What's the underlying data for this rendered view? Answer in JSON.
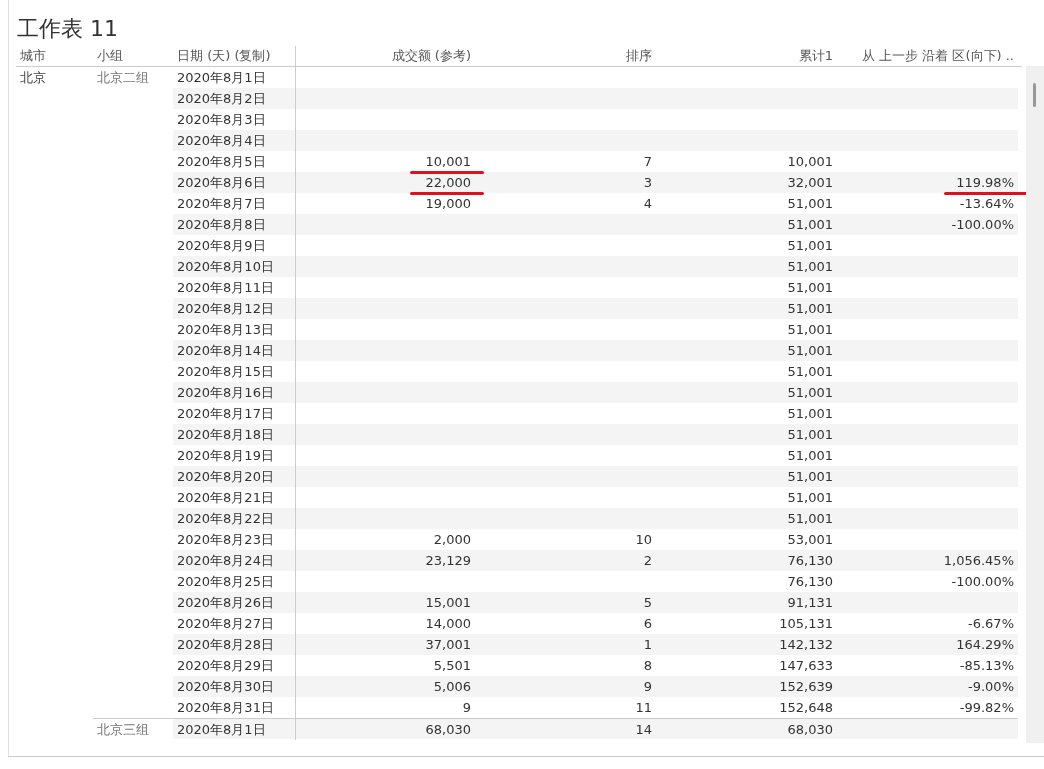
{
  "title": "工作表 11",
  "columns": [
    "城市",
    "小组",
    "日期 (天) (复制)",
    "成交额 (参考)",
    "排序",
    "累计1",
    "从 上一步 沿着 区(向下) .."
  ],
  "cities": [
    {
      "name": "北京",
      "groups": [
        {
          "name": "北京二组",
          "rows": [
            {
              "date": "2020年8月1日",
              "amount_marked": false,
              "change_marked": false
            },
            {
              "date": "2020年8月2日",
              "amount_marked": false,
              "change_marked": false
            },
            {
              "date": "2020年8月3日",
              "amount_marked": false,
              "change_marked": false
            },
            {
              "date": "2020年8月4日",
              "amount_marked": false,
              "change_marked": false
            },
            {
              "date": "2020年8月5日",
              "amount": "10,001",
              "rank": "7",
              "cumulative": "10,001",
              "amount_marked": true,
              "change_marked": false
            },
            {
              "date": "2020年8月6日",
              "amount": "22,000",
              "rank": "3",
              "cumulative": "32,001",
              "change": "119.98%",
              "amount_marked": true,
              "change_marked": true
            },
            {
              "date": "2020年8月7日",
              "amount": "19,000",
              "rank": "4",
              "cumulative": "51,001",
              "change": "-13.64%",
              "amount_marked": false,
              "change_marked": false
            },
            {
              "date": "2020年8月8日",
              "cumulative": "51,001",
              "change": "-100.00%",
              "amount_marked": false,
              "change_marked": false
            },
            {
              "date": "2020年8月9日",
              "cumulative": "51,001",
              "amount_marked": false,
              "change_marked": false
            },
            {
              "date": "2020年8月10日",
              "cumulative": "51,001",
              "amount_marked": false,
              "change_marked": false
            },
            {
              "date": "2020年8月11日",
              "cumulative": "51,001",
              "amount_marked": false,
              "change_marked": false
            },
            {
              "date": "2020年8月12日",
              "cumulative": "51,001",
              "amount_marked": false,
              "change_marked": false
            },
            {
              "date": "2020年8月13日",
              "cumulative": "51,001",
              "amount_marked": false,
              "change_marked": false
            },
            {
              "date": "2020年8月14日",
              "cumulative": "51,001",
              "amount_marked": false,
              "change_marked": false
            },
            {
              "date": "2020年8月15日",
              "cumulative": "51,001",
              "amount_marked": false,
              "change_marked": false
            },
            {
              "date": "2020年8月16日",
              "cumulative": "51,001",
              "amount_marked": false,
              "change_marked": false
            },
            {
              "date": "2020年8月17日",
              "cumulative": "51,001",
              "amount_marked": false,
              "change_marked": false
            },
            {
              "date": "2020年8月18日",
              "cumulative": "51,001",
              "amount_marked": false,
              "change_marked": false
            },
            {
              "date": "2020年8月19日",
              "cumulative": "51,001",
              "amount_marked": false,
              "change_marked": false
            },
            {
              "date": "2020年8月20日",
              "cumulative": "51,001",
              "amount_marked": false,
              "change_marked": false
            },
            {
              "date": "2020年8月21日",
              "cumulative": "51,001",
              "amount_marked": false,
              "change_marked": false
            },
            {
              "date": "2020年8月22日",
              "cumulative": "51,001",
              "amount_marked": false,
              "change_marked": false
            },
            {
              "date": "2020年8月23日",
              "amount": "2,000",
              "rank": "10",
              "cumulative": "53,001",
              "amount_marked": false,
              "change_marked": false
            },
            {
              "date": "2020年8月24日",
              "amount": "23,129",
              "rank": "2",
              "cumulative": "76,130",
              "change": "1,056.45%",
              "amount_marked": false,
              "change_marked": false
            },
            {
              "date": "2020年8月25日",
              "cumulative": "76,130",
              "change": "-100.00%",
              "amount_marked": false,
              "change_marked": false
            },
            {
              "date": "2020年8月26日",
              "amount": "15,001",
              "rank": "5",
              "cumulative": "91,131",
              "amount_marked": false,
              "change_marked": false
            },
            {
              "date": "2020年8月27日",
              "amount": "14,000",
              "rank": "6",
              "cumulative": "105,131",
              "change": "-6.67%",
              "amount_marked": false,
              "change_marked": false
            },
            {
              "date": "2020年8月28日",
              "amount": "37,001",
              "rank": "1",
              "cumulative": "142,132",
              "change": "164.29%",
              "amount_marked": false,
              "change_marked": false
            },
            {
              "date": "2020年8月29日",
              "amount": "5,501",
              "rank": "8",
              "cumulative": "147,633",
              "change": "-85.13%",
              "amount_marked": false,
              "change_marked": false
            },
            {
              "date": "2020年8月30日",
              "amount": "5,006",
              "rank": "9",
              "cumulative": "152,639",
              "change": "-9.00%",
              "amount_marked": false,
              "change_marked": false
            },
            {
              "date": "2020年8月31日",
              "amount": "9",
              "rank": "11",
              "cumulative": "152,648",
              "change": "-99.82%",
              "amount_marked": false,
              "change_marked": false
            }
          ]
        },
        {
          "name": "北京三组",
          "rows": [
            {
              "date": "2020年8月1日",
              "amount": "68,030",
              "rank": "14",
              "cumulative": "68,030",
              "amount_marked": false,
              "change_marked": false
            }
          ]
        }
      ]
    }
  ]
}
